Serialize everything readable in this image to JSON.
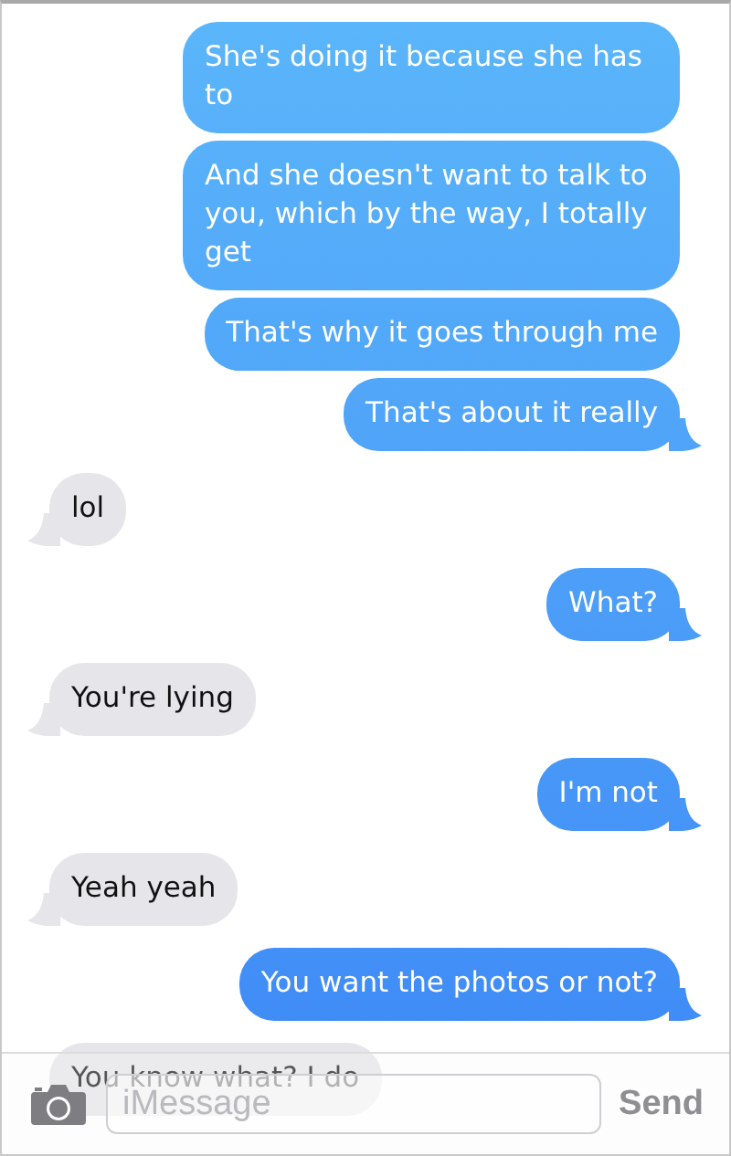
{
  "messages": [
    {
      "kind": "sent",
      "text": "She's doing it because she has to",
      "tail": false
    },
    {
      "kind": "sent",
      "text": "And she doesn't want to talk to you, which by the way, I totally get",
      "tail": false
    },
    {
      "kind": "sent",
      "text": "That's why it goes through me",
      "tail": false
    },
    {
      "kind": "sent",
      "text": "That's about it really",
      "tail": true
    },
    {
      "kind": "received",
      "text": "lol",
      "tail": true
    },
    {
      "kind": "sent",
      "text": "What?",
      "tail": true
    },
    {
      "kind": "received",
      "text": "You're lying",
      "tail": true
    },
    {
      "kind": "sent",
      "text": "I'm not",
      "tail": true
    },
    {
      "kind": "received",
      "text": "Yeah yeah",
      "tail": true
    },
    {
      "kind": "sent",
      "text": "You want the photos or not?",
      "tail": true
    },
    {
      "kind": "received",
      "text": "You know what? I do",
      "tail": false
    }
  ],
  "composer": {
    "placeholder": "iMessage",
    "send_label": "Send",
    "send_disabled": true
  }
}
